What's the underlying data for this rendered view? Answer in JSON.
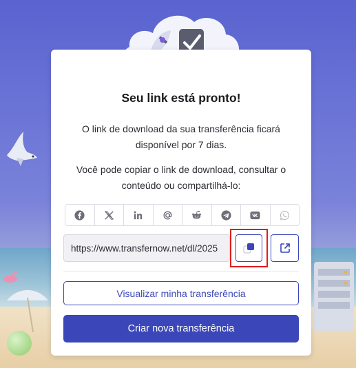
{
  "modal": {
    "title": "Seu link está pronto!",
    "desc1": "O link de download da sua transferência ficará disponível por 7 dias.",
    "desc2": "Você pode copiar o link de download, consultar o conteúdo ou compartilhá-lo:",
    "share_icons": [
      "facebook-icon",
      "x-icon",
      "linkedin-icon",
      "email-icon",
      "reddit-icon",
      "telegram-icon",
      "vk-icon",
      "whatsapp-icon"
    ],
    "link_value": "https://www.transfernow.net/dl/2025",
    "view_label": "Visualizar minha transferência",
    "new_label": "Criar nova transferência"
  },
  "colors": {
    "accent": "#3b47b8",
    "highlight": "#e11d1d",
    "icon_gray": "#6e6e78"
  }
}
